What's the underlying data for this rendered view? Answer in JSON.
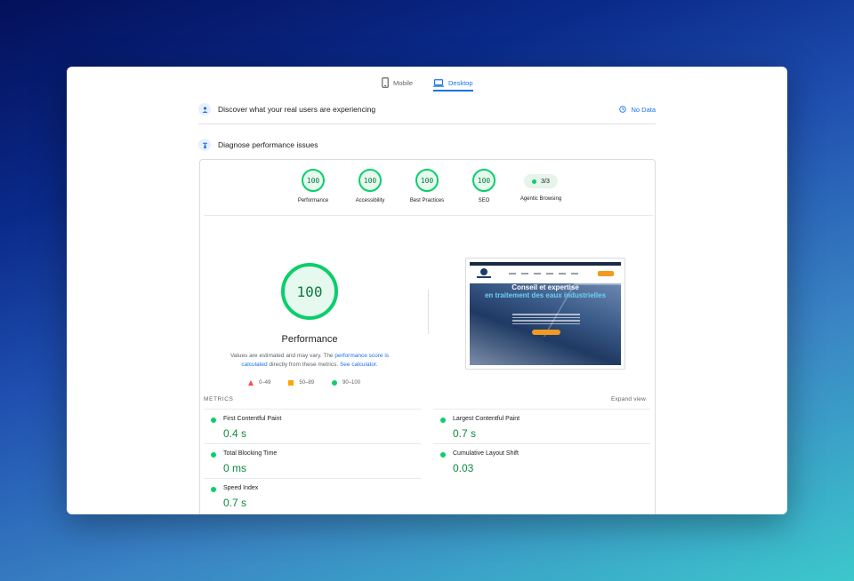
{
  "tabs": [
    {
      "label": "Mobile",
      "icon": "phone-icon",
      "active": false
    },
    {
      "label": "Desktop",
      "icon": "laptop-icon",
      "active": true
    }
  ],
  "field_data": {
    "title": "Discover what your real users are experiencing",
    "status": "No Data"
  },
  "diagnose": {
    "title": "Diagnose performance issues"
  },
  "scores": [
    {
      "label": "Performance",
      "value": "100"
    },
    {
      "label": "Accessibility",
      "value": "100"
    },
    {
      "label": "Best Practices",
      "value": "100"
    },
    {
      "label": "SEO",
      "value": "100"
    }
  ],
  "agentic": {
    "label": "Agentic Browsing",
    "value": "3/3"
  },
  "performance": {
    "score": "100",
    "title": "Performance",
    "note_part1": "Values are estimated and may vary. The ",
    "note_link1": "performance score is calculated",
    "note_part2": " directly from these metrics. ",
    "note_link2": "See calculator."
  },
  "legend": {
    "fail": "0–49",
    "average": "50–89",
    "pass": "90–100"
  },
  "screenshot": {
    "headline": "Conseil et expertise",
    "headline_accent": "en traitement des eaux industrielles"
  },
  "metrics": {
    "header": "METRICS",
    "expand_label": "Expand view",
    "items": [
      {
        "name": "First Contentful Paint",
        "value": "0.4 s"
      },
      {
        "name": "Largest Contentful Paint",
        "value": "0.7 s"
      },
      {
        "name": "Total Blocking Time",
        "value": "0 ms"
      },
      {
        "name": "Cumulative Layout Shift",
        "value": "0.03"
      },
      {
        "name": "Speed Index",
        "value": "0.7 s"
      }
    ]
  },
  "colors": {
    "pass": "#0cce6b",
    "average": "#ffa400",
    "fail": "#ff4e42",
    "accent": "#1a73e8"
  }
}
